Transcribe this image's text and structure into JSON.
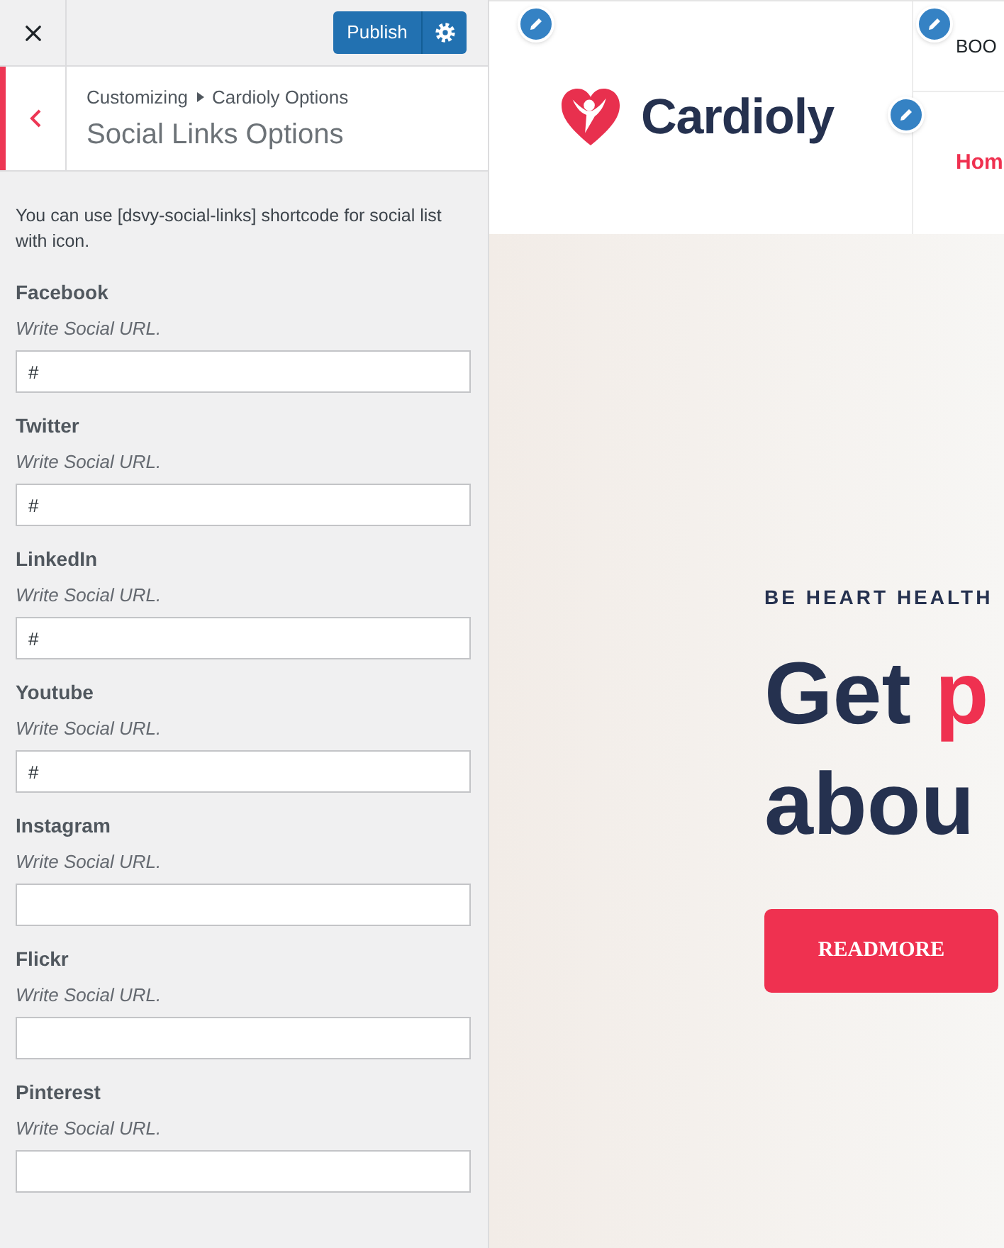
{
  "panel": {
    "publish_button": "Publish",
    "breadcrumb": [
      "Customizing",
      "Cardioly Options"
    ],
    "title": "Social Links Options",
    "notice": "You can use [dsvy-social-links] shortcode for social list with icon.",
    "fields": [
      {
        "label": "Facebook",
        "description": "Write Social URL.",
        "value": "#"
      },
      {
        "label": "Twitter",
        "description": "Write Social URL.",
        "value": "#"
      },
      {
        "label": "LinkedIn",
        "description": "Write Social URL.",
        "value": "#"
      },
      {
        "label": "Youtube",
        "description": "Write Social URL.",
        "value": "#"
      },
      {
        "label": "Instagram",
        "description": "Write Social URL."
      },
      {
        "label": "Flickr",
        "description": "Write Social URL."
      },
      {
        "label": "Pinterest",
        "description": "Write Social URL."
      }
    ]
  },
  "preview": {
    "logo_text": "Cardioly",
    "top_link": "BOO",
    "nav_link": "Hom",
    "hero": {
      "kicker": "BE HEART HEALTH",
      "heading_lines": [
        [
          {
            "text": "Get",
            "accent": false
          },
          {
            "text": "p",
            "accent": true
          }
        ],
        [
          {
            "text": "abou",
            "accent": false
          }
        ]
      ],
      "button": "READMORE"
    }
  }
}
